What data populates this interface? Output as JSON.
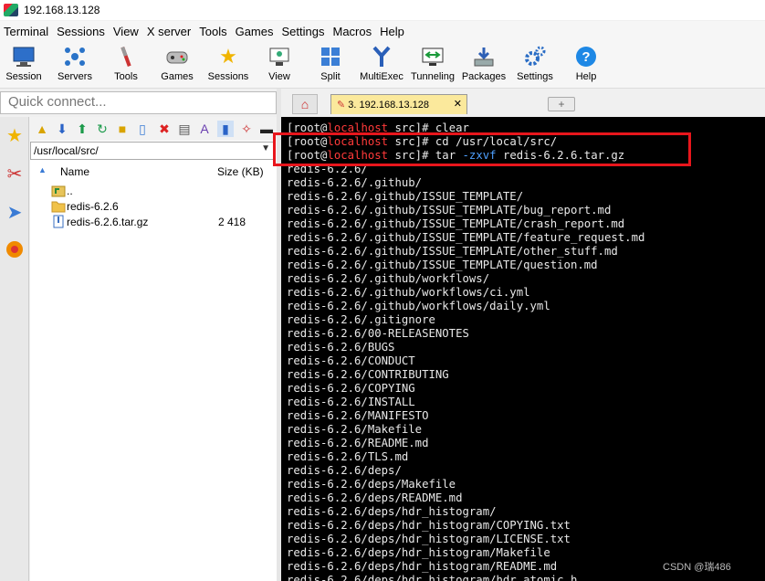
{
  "window": {
    "title": "192.168.13.128"
  },
  "menu": [
    "Terminal",
    "Sessions",
    "View",
    "X server",
    "Tools",
    "Games",
    "Settings",
    "Macros",
    "Help"
  ],
  "toolbar": [
    {
      "label": "Session",
      "icon": "session-icon"
    },
    {
      "label": "Servers",
      "icon": "servers-icon"
    },
    {
      "label": "Tools",
      "icon": "tools-icon"
    },
    {
      "label": "Games",
      "icon": "games-icon"
    },
    {
      "label": "Sessions",
      "icon": "star-icon"
    },
    {
      "label": "View",
      "icon": "view-icon"
    },
    {
      "label": "Split",
      "icon": "split-icon"
    },
    {
      "label": "MultiExec",
      "icon": "multiexec-icon"
    },
    {
      "label": "Tunneling",
      "icon": "tunneling-icon"
    },
    {
      "label": "Packages",
      "icon": "packages-icon"
    },
    {
      "label": "Settings",
      "icon": "settings-icon"
    },
    {
      "label": "Help",
      "icon": "help-icon"
    }
  ],
  "quick_connect": {
    "placeholder": "Quick connect..."
  },
  "sftp": {
    "path": "/usr/local/src/",
    "columns": {
      "name": "Name",
      "size": "Size (KB)"
    },
    "files": [
      {
        "name": "..",
        "size": "",
        "type": "parent"
      },
      {
        "name": "redis-6.2.6",
        "size": "",
        "type": "folder"
      },
      {
        "name": "redis-6.2.6.tar.gz",
        "size": "2 418",
        "type": "file"
      }
    ]
  },
  "tabs": {
    "active_label": "3. 192.168.13.128",
    "close": "✕"
  },
  "terminal": {
    "prompt_user": "[root@",
    "prompt_host": "localhost",
    "prompt_dir": " src]# ",
    "cmd1": "clear",
    "cmd2": "cd /usr/local/src/",
    "cmd3_a": "tar ",
    "cmd3_flag": "-zxvf",
    "cmd3_b": " redis-6.2.6.tar.gz",
    "output": [
      "redis-6.2.6/",
      "redis-6.2.6/.github/",
      "redis-6.2.6/.github/ISSUE_TEMPLATE/",
      "redis-6.2.6/.github/ISSUE_TEMPLATE/bug_report.md",
      "redis-6.2.6/.github/ISSUE_TEMPLATE/crash_report.md",
      "redis-6.2.6/.github/ISSUE_TEMPLATE/feature_request.md",
      "redis-6.2.6/.github/ISSUE_TEMPLATE/other_stuff.md",
      "redis-6.2.6/.github/ISSUE_TEMPLATE/question.md",
      "redis-6.2.6/.github/workflows/",
      "redis-6.2.6/.github/workflows/ci.yml",
      "redis-6.2.6/.github/workflows/daily.yml",
      "redis-6.2.6/.gitignore",
      "redis-6.2.6/00-RELEASENOTES",
      "redis-6.2.6/BUGS",
      "redis-6.2.6/CONDUCT",
      "redis-6.2.6/CONTRIBUTING",
      "redis-6.2.6/COPYING",
      "redis-6.2.6/INSTALL",
      "redis-6.2.6/MANIFESTO",
      "redis-6.2.6/Makefile",
      "redis-6.2.6/README.md",
      "redis-6.2.6/TLS.md",
      "redis-6.2.6/deps/",
      "redis-6.2.6/deps/Makefile",
      "redis-6.2.6/deps/README.md",
      "redis-6.2.6/deps/hdr_histogram/",
      "redis-6.2.6/deps/hdr_histogram/COPYING.txt",
      "redis-6.2.6/deps/hdr_histogram/LICENSE.txt",
      "redis-6.2.6/deps/hdr_histogram/Makefile",
      "redis-6.2.6/deps/hdr_histogram/README.md",
      "redis-6.2.6/deps/hdr_histogram/hdr_atomic.h"
    ]
  },
  "watermark": "CSDN @瑞486",
  "colors": {
    "highlight_box": "#e8161c",
    "prompt_host": "#ff3a3a",
    "tab_active": "#fbe99c"
  }
}
